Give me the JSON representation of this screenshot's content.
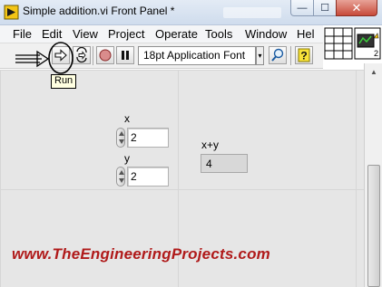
{
  "window": {
    "title": "Simple addition.vi Front Panel *",
    "controls": {
      "minimize": "—",
      "maximize": "☐",
      "close": "✕"
    }
  },
  "menu": {
    "items": [
      "File",
      "Edit",
      "View",
      "Project",
      "Operate",
      "Tools",
      "Window",
      "Hel"
    ]
  },
  "toolbar": {
    "run_tooltip": "Run",
    "font": "18pt Application Font",
    "dropdown_arrow": "▾",
    "icons": [
      "run-icon",
      "run-continuously-icon",
      "abort-icon",
      "pause-icon",
      "search-icon",
      "help-icon"
    ]
  },
  "panel": {
    "control_x": {
      "label": "x",
      "value": "2"
    },
    "control_y": {
      "label": "y",
      "value": "2"
    },
    "indicator_sum": {
      "label": "x+y",
      "value": "4"
    }
  },
  "connector": {
    "terminal_count": "2"
  },
  "watermark": "www.TheEngineeringProjects.com",
  "colors": {
    "watermark": "#b01a1a",
    "panel_bg": "#e6e6e6",
    "abort_red": "#d02020",
    "annotation": "#000000"
  }
}
